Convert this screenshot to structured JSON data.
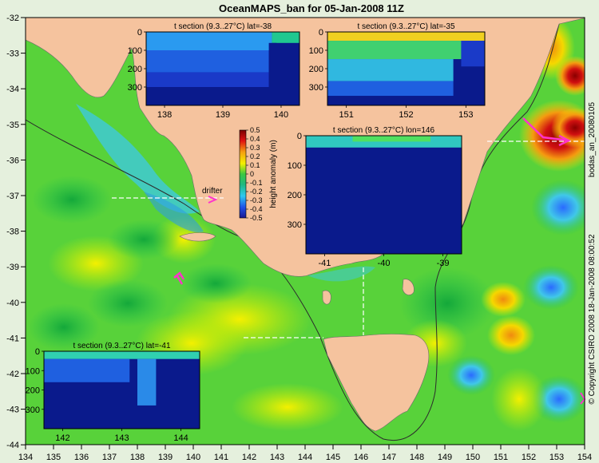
{
  "title": "OceanMAPS_ban for 05-Jan-2008 11Z",
  "side_label": "bodas_an_20080105",
  "side_footer": "© Copyright CSIRO 2008   18-Jan-2008 08:00:52",
  "colors": {
    "land": "#f5c39e",
    "frame": "#c5ddb3",
    "section_line": "#ffffff",
    "arrow": "#ff33cc"
  },
  "lon_ticks": [
    "134",
    "135",
    "136",
    "137",
    "138",
    "139",
    "140",
    "141",
    "142",
    "143",
    "144",
    "145",
    "146",
    "147",
    "148",
    "149",
    "150",
    "151",
    "152",
    "153",
    "154"
  ],
  "lat_ticks": [
    "-32",
    "-33",
    "-34",
    "-35",
    "-36",
    "-37",
    "-38",
    "-39",
    "-40",
    "-41",
    "-42",
    "-43",
    "-44"
  ],
  "drifter_label": "drifter",
  "colorbar": {
    "label": "height anomaly (m)",
    "ticks": [
      "0.5",
      "0.4",
      "0.3",
      "0.2",
      "0.1",
      "0",
      "-0.1",
      "-0.2",
      "-0.3",
      "-0.4",
      "-0.5"
    ]
  },
  "insets": {
    "sec1": {
      "title": "t section (9.3..27°C) lat=-38",
      "yticks": [
        "0",
        "100",
        "200",
        "300"
      ],
      "xticks": [
        "138",
        "139",
        "140"
      ]
    },
    "sec2": {
      "title": "t section (9.3..27°C) lat=-35",
      "yticks": [
        "0",
        "100",
        "200",
        "300"
      ],
      "xticks": [
        "151",
        "152",
        "153"
      ]
    },
    "sec3": {
      "title": "t section (9.3..27°C) lon=146",
      "yticks": [
        "0",
        "100",
        "200",
        "300"
      ],
      "xticks": [
        "-41",
        "-40",
        "-39"
      ]
    },
    "sec4": {
      "title": "t section (9.3..27°C) lat=-41",
      "yticks": [
        "0",
        "100",
        "200",
        "300"
      ],
      "xticks": [
        "142",
        "143",
        "144"
      ]
    }
  }
}
